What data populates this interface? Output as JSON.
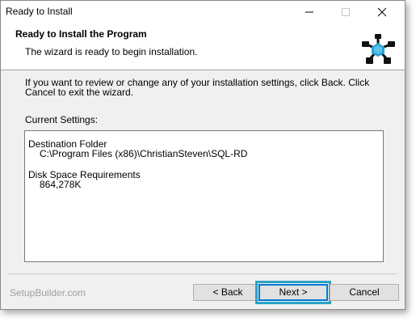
{
  "window": {
    "title": "Ready to Install"
  },
  "header": {
    "title": "Ready to Install the Program",
    "subtitle": "The wizard is ready to begin installation."
  },
  "body": {
    "instructions": "If you want to review or change any of your installation settings, click Back. Click Cancel to exit the wizard.",
    "current_settings_label": "Current Settings:",
    "settings": {
      "destination_heading": "Destination Folder",
      "destination_value": "C:\\Program Files (x86)\\ChristianSteven\\SQL-RD",
      "disk_heading": "Disk Space Requirements",
      "disk_value": "864,278K"
    }
  },
  "footer": {
    "brand": "SetupBuilder.com",
    "back_label": "< Back",
    "next_label": "Next >",
    "cancel_label": "Cancel"
  },
  "colors": {
    "accent": "#0078d7",
    "focus_ring": "#2aa4c4",
    "logo_blue": "#29a3d6"
  },
  "icons": [
    "minimize-icon",
    "maximize-icon",
    "close-icon",
    "setup-logo-icon"
  ]
}
